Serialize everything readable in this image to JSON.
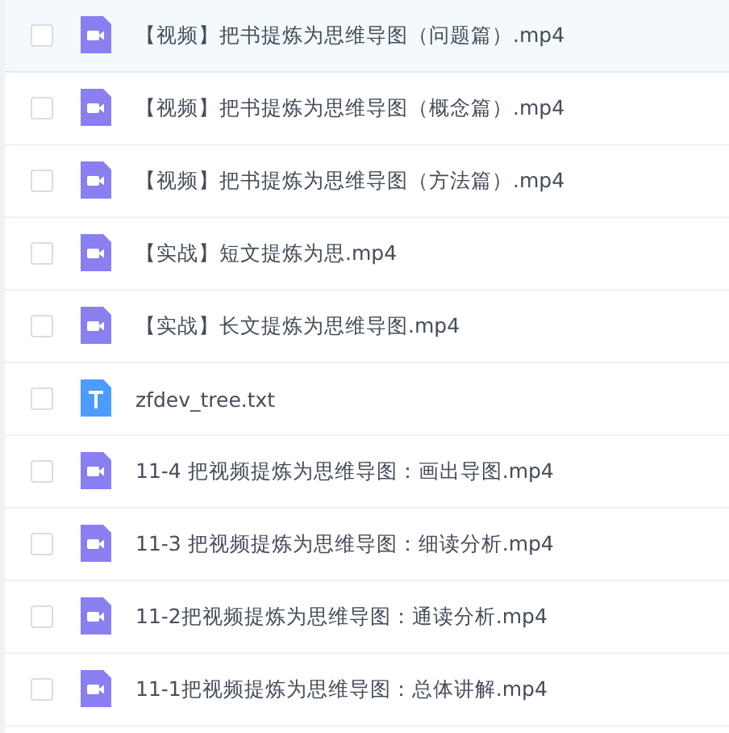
{
  "files": [
    {
      "name": "【视频】把书提炼为思维导图（问题篇）.mp4",
      "kind": "video",
      "checked": false,
      "selected": true
    },
    {
      "name": "【视频】把书提炼为思维导图（概念篇）.mp4",
      "kind": "video",
      "checked": false,
      "selected": false
    },
    {
      "name": "【视频】把书提炼为思维导图（方法篇）.mp4",
      "kind": "video",
      "checked": false,
      "selected": false
    },
    {
      "name": "【实战】短文提炼为思.mp4",
      "kind": "video",
      "checked": false,
      "selected": false
    },
    {
      "name": "【实战】长文提炼为思维导图.mp4",
      "kind": "video",
      "checked": false,
      "selected": false
    },
    {
      "name": "zfdev_tree.txt",
      "kind": "text",
      "checked": false,
      "selected": false
    },
    {
      "name": "11-4 把视频提炼为思维导图：画出导图.mp4",
      "kind": "video",
      "checked": false,
      "selected": false
    },
    {
      "name": "11-3 把视频提炼为思维导图：细读分析.mp4",
      "kind": "video",
      "checked": false,
      "selected": false
    },
    {
      "name": "11-2把视频提炼为思维导图：通读分析.mp4",
      "kind": "video",
      "checked": false,
      "selected": false
    },
    {
      "name": "11-1把视频提炼为思维导图：总体讲解.mp4",
      "kind": "video",
      "checked": false,
      "selected": false
    }
  ]
}
